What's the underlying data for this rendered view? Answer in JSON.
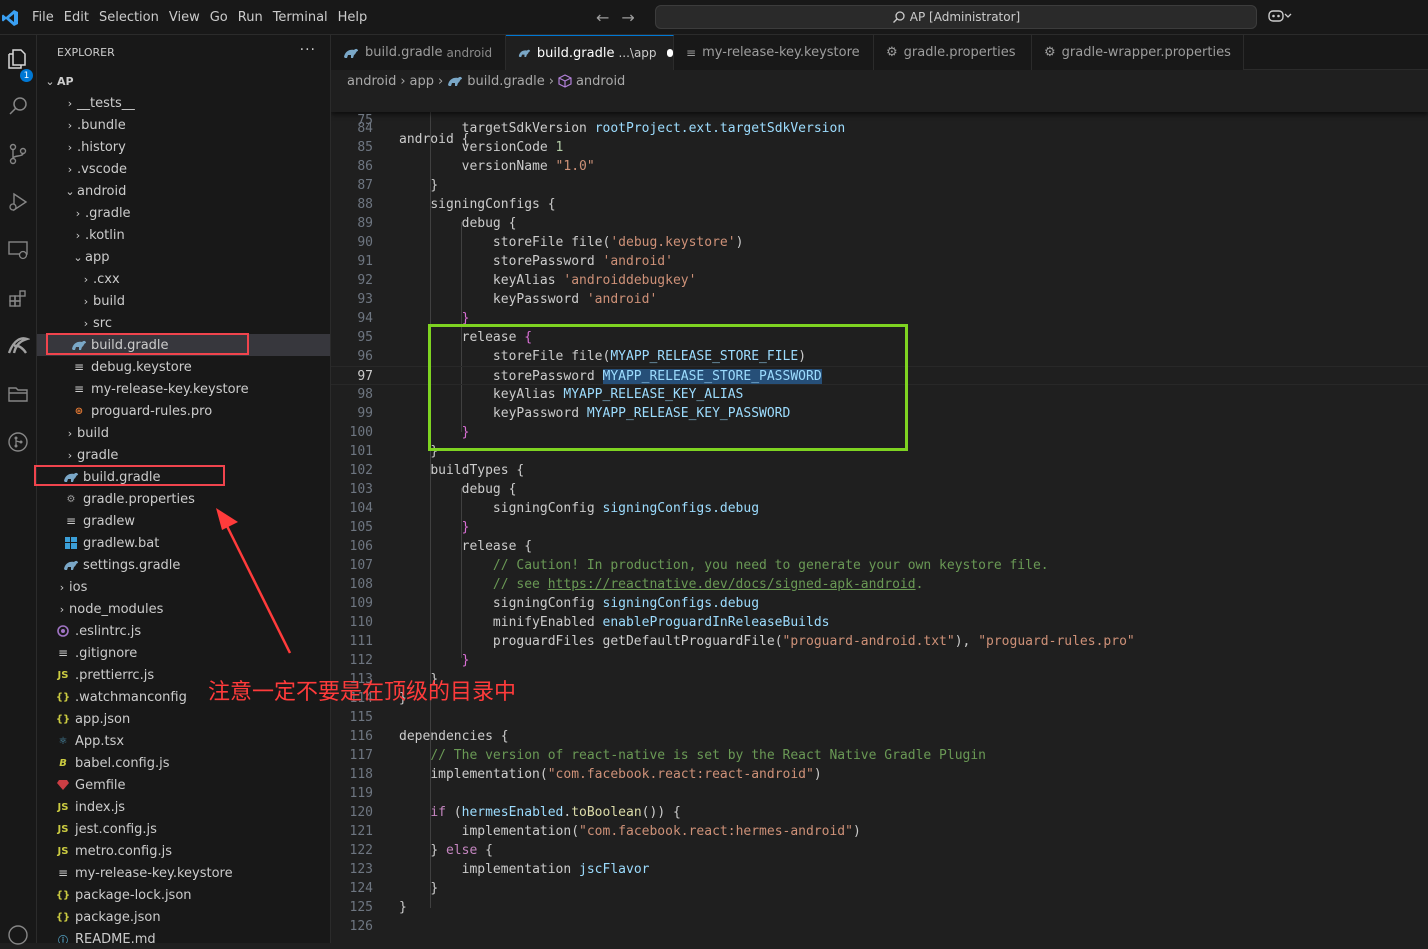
{
  "titlebar": {
    "menu": [
      "File",
      "Edit",
      "Selection",
      "View",
      "Go",
      "Run",
      "Terminal",
      "Help"
    ],
    "search_text": "AP [Administrator]"
  },
  "activity_badge": "1",
  "explorer": {
    "title": "EXPLORER",
    "more": "···",
    "root": "AP",
    "items": [
      {
        "label": "__tests__",
        "icon": "chevron-right-icon"
      },
      {
        "label": ".bundle",
        "icon": "chevron-right-icon"
      },
      {
        "label": ".history",
        "icon": "chevron-right-icon"
      },
      {
        "label": ".vscode",
        "icon": "chevron-right-icon"
      },
      {
        "label": "android",
        "icon": "chevron-down-icon"
      },
      {
        "label": ".gradle",
        "icon": "chevron-right-icon"
      },
      {
        "label": ".kotlin",
        "icon": "chevron-right-icon"
      },
      {
        "label": "app",
        "icon": "chevron-down-icon"
      },
      {
        "label": ".cxx",
        "icon": "chevron-right-icon"
      },
      {
        "label": "build",
        "icon": "chevron-right-icon"
      },
      {
        "label": "src",
        "icon": "chevron-right-icon"
      },
      {
        "label": "build.gradle",
        "icon": "gradle-icon"
      },
      {
        "label": "debug.keystore",
        "icon": "lines-icon"
      },
      {
        "label": "my-release-key.keystore",
        "icon": "lines-icon"
      },
      {
        "label": "proguard-rules.pro",
        "icon": "proguard-icon"
      },
      {
        "label": "build",
        "icon": "chevron-right-icon"
      },
      {
        "label": "gradle",
        "icon": "chevron-right-icon"
      },
      {
        "label": "build.gradle",
        "icon": "gradle-icon"
      },
      {
        "label": "gradle.properties",
        "icon": "gear-icon"
      },
      {
        "label": "gradlew",
        "icon": "lines-icon"
      },
      {
        "label": "gradlew.bat",
        "icon": "windows-icon"
      },
      {
        "label": "settings.gradle",
        "icon": "gradle-icon"
      },
      {
        "label": "ios",
        "icon": "chevron-right-icon"
      },
      {
        "label": "node_modules",
        "icon": "chevron-right-icon"
      },
      {
        "label": ".eslintrc.js",
        "icon": "eslint-icon"
      },
      {
        "label": ".gitignore",
        "icon": "lines-icon"
      },
      {
        "label": ".prettierrc.js",
        "icon": "js-icon"
      },
      {
        "label": ".watchmanconfig",
        "icon": "json-icon"
      },
      {
        "label": "app.json",
        "icon": "json-icon"
      },
      {
        "label": "App.tsx",
        "icon": "react-icon"
      },
      {
        "label": "babel.config.js",
        "icon": "babel-icon"
      },
      {
        "label": "Gemfile",
        "icon": "ruby-icon"
      },
      {
        "label": "index.js",
        "icon": "js-icon"
      },
      {
        "label": "jest.config.js",
        "icon": "js-icon"
      },
      {
        "label": "metro.config.js",
        "icon": "js-icon"
      },
      {
        "label": "my-release-key.keystore",
        "icon": "lines-icon"
      },
      {
        "label": "package-lock.json",
        "icon": "json-icon"
      },
      {
        "label": "package.json",
        "icon": "json-icon"
      },
      {
        "label": "README.md",
        "icon": "info-icon"
      }
    ]
  },
  "tabs": [
    {
      "label": "build.gradle",
      "sub": "android"
    },
    {
      "label": "build.gradle",
      "sub": "...\\app"
    },
    {
      "label": "my-release-key.keystore",
      "sub": ""
    },
    {
      "label": "gradle.properties",
      "sub": ""
    },
    {
      "label": "gradle-wrapper.properties",
      "sub": ""
    }
  ],
  "breadcrumb": [
    "android",
    "app",
    "build.gradle",
    "android"
  ],
  "sticky": {
    "line": "75",
    "text": "android {"
  },
  "code_lines": [
    {
      "n": "84"
    },
    {
      "n": "85"
    },
    {
      "n": "86"
    },
    {
      "n": "87"
    },
    {
      "n": "88"
    },
    {
      "n": "89"
    },
    {
      "n": "90"
    },
    {
      "n": "91"
    },
    {
      "n": "92"
    },
    {
      "n": "93"
    },
    {
      "n": "94"
    },
    {
      "n": "95"
    },
    {
      "n": "96"
    },
    {
      "n": "97"
    },
    {
      "n": "98"
    },
    {
      "n": "99"
    },
    {
      "n": "100"
    },
    {
      "n": "101"
    },
    {
      "n": "102"
    },
    {
      "n": "103"
    },
    {
      "n": "104"
    },
    {
      "n": "105"
    },
    {
      "n": "106"
    },
    {
      "n": "107"
    },
    {
      "n": "108"
    },
    {
      "n": "109"
    },
    {
      "n": "110"
    },
    {
      "n": "111"
    },
    {
      "n": "112"
    },
    {
      "n": "113"
    },
    {
      "n": "114"
    },
    {
      "n": "115"
    },
    {
      "n": "116"
    },
    {
      "n": "117"
    },
    {
      "n": "118"
    },
    {
      "n": "119"
    },
    {
      "n": "120"
    },
    {
      "n": "121"
    },
    {
      "n": "122"
    },
    {
      "n": "123"
    },
    {
      "n": "124"
    },
    {
      "n": "125"
    },
    {
      "n": "126"
    }
  ],
  "code": {
    "l84": [
      "targetSdkVersion",
      "rootProject.ext.targetSdkVersion"
    ],
    "l85": [
      "versionCode",
      "1"
    ],
    "l86": [
      "versionName",
      "\"1.0\""
    ],
    "l87": "}",
    "l88": "signingConfigs {",
    "l89": "debug {",
    "l90": [
      "storeFile",
      "file(",
      "'debug.keystore'",
      ")"
    ],
    "l91": [
      "storePassword",
      "'android'"
    ],
    "l92": [
      "keyAlias",
      "'androiddebugkey'"
    ],
    "l93": [
      "keyPassword",
      "'android'"
    ],
    "l94": "}",
    "l95": [
      "release",
      "{"
    ],
    "l96": [
      "storeFile",
      "file(",
      "MYAPP_RELEASE_STORE_FILE",
      ")"
    ],
    "l97": [
      "storePassword",
      "MYAPP_RELEASE_STORE_PASSWORD"
    ],
    "l98": [
      "keyAlias",
      "MYAPP_RELEASE_KEY_ALIAS"
    ],
    "l99": [
      "keyPassword",
      "MYAPP_RELEASE_KEY_PASSWORD"
    ],
    "l100": "}",
    "l101": "}",
    "l102": "buildTypes {",
    "l103": "debug {",
    "l104": [
      "signingConfig",
      "signingConfigs.debug"
    ],
    "l105": "}",
    "l106": "release {",
    "l107": "// Caution! In production, you need to generate your own keystore file.",
    "l108": [
      "// see ",
      "https://reactnative.dev/docs/signed-apk-android",
      "."
    ],
    "l109": [
      "signingConfig",
      "signingConfigs.debug"
    ],
    "l110": [
      "minifyEnabled",
      "enableProguardInReleaseBuilds"
    ],
    "l111": [
      "proguardFiles",
      "getDefaultProguardFile",
      "(",
      "\"proguard-android.txt\"",
      "),",
      "\"proguard-rules.pro\""
    ],
    "l112": "}",
    "l113": "}",
    "l114": "}",
    "l116": "dependencies {",
    "l117": "// The version of react-native is set by the React Native Gradle Plugin",
    "l118": [
      "implementation",
      "(",
      "\"com.facebook.react:react-android\"",
      ")"
    ],
    "l120": [
      "if",
      "(",
      "hermesEnabled",
      ".",
      "toBoolean",
      "()",
      ") {"
    ],
    "l121": [
      "implementation",
      "(",
      "\"com.facebook.react:hermes-android\"",
      ")"
    ],
    "l122": [
      "} ",
      "else",
      " {"
    ],
    "l123": [
      "implementation",
      "jscFlavor"
    ],
    "l124": "}",
    "l125": "}"
  },
  "annotation": "注意一定不要是在顶级的目录中",
  "colors": {
    "red_box": "#f0444d",
    "green_box": "#7ed321",
    "annotation": "#ff3b3b",
    "accent": "#0078d4"
  }
}
